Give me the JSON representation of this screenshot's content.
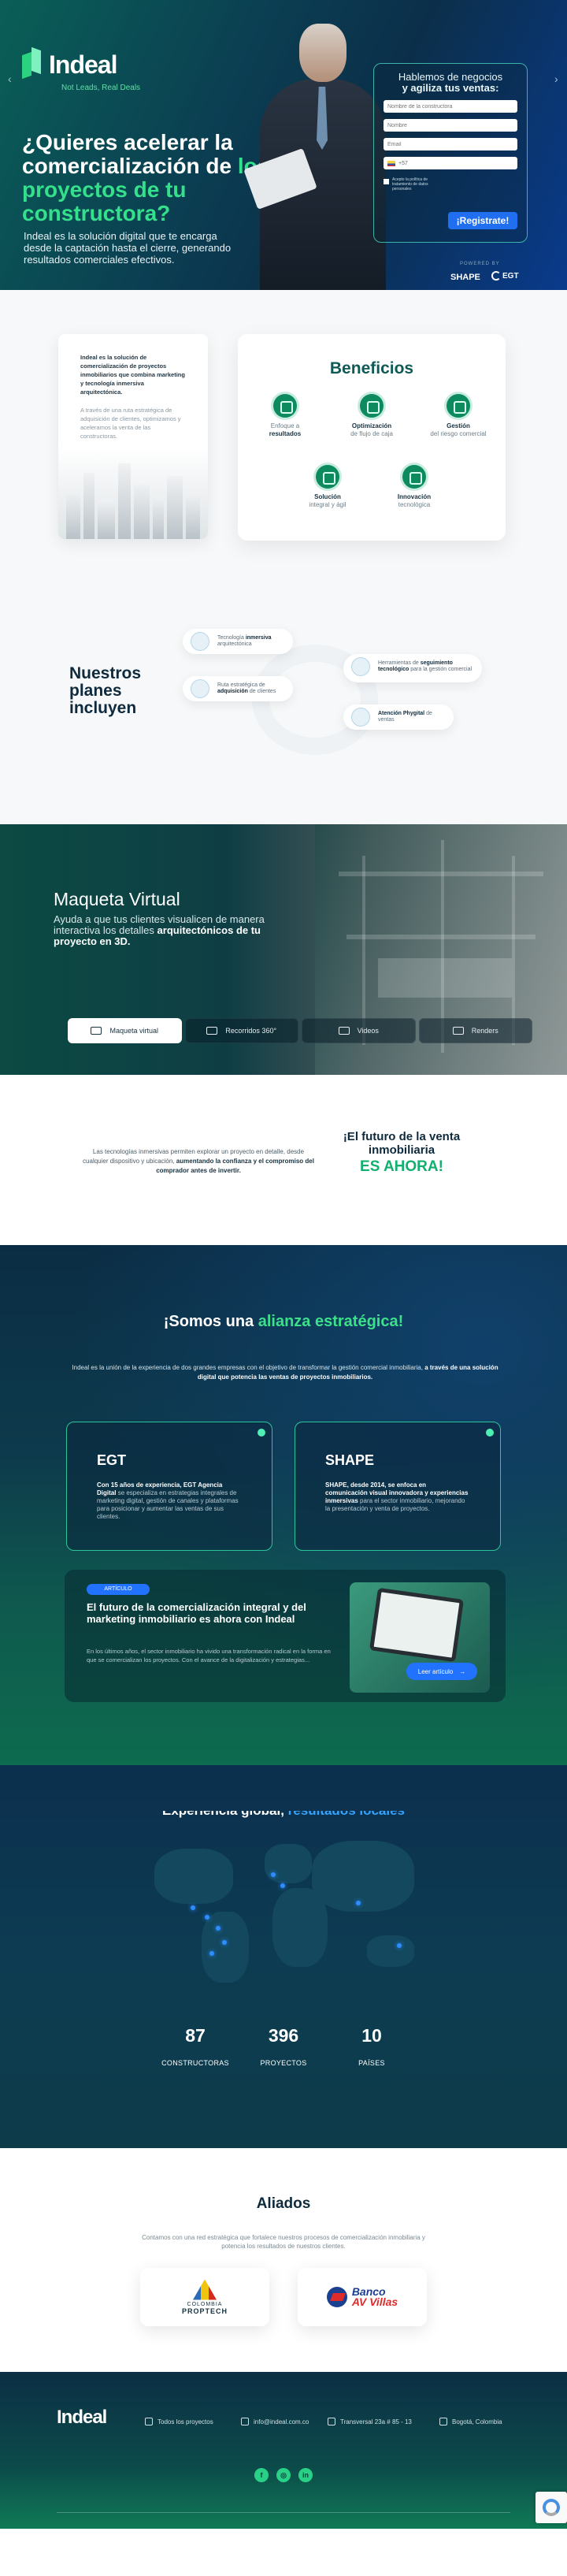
{
  "brand": {
    "name": "Indeal",
    "tagline": "Not Leads, Real Deals"
  },
  "hero": {
    "title_1": "¿Quieres acelerar la comercialización de",
    "title_2": "los proyectos de tu constructora?",
    "lead": "Indeal es la solución digital que te encarga desde la captación hasta el cierre, generando resultados comerciales efectivos.",
    "prev": "‹",
    "next": "›",
    "powered": "POWERED BY",
    "shape": "SHAPE",
    "egt": "EGT"
  },
  "form": {
    "title_1": "Hablemos de negocios",
    "title_2": "y agiliza tus ventas:",
    "company_placeholder": "Nombre de la constructora",
    "name_placeholder": "Nombre",
    "email_placeholder": "Email",
    "phone_prefix": "+57",
    "consent": "Acepto la política de tratamiento de datos personales",
    "submit": "¡Registrate!"
  },
  "intro": {
    "p1": "Indeal es la solución de comercialización de proyectos inmobiliarios que combina marketing y tecnología inmersiva arquitectónica.",
    "p2": "A través de una ruta estratégica de adquisición de clientes, optimizamos y aceleramos la venta de las constructoras."
  },
  "benefits": {
    "title": "Beneficios",
    "items": [
      {
        "pre": "Enfoque a",
        "b": "resultados"
      },
      {
        "pre": "",
        "b": "Optimización",
        "post": "de flujo de caja"
      },
      {
        "pre": "",
        "b": "Gestión",
        "post": "del riesgo comercial"
      },
      {
        "pre": "",
        "b": "Solución",
        "post": "integral y ágil"
      },
      {
        "pre": "",
        "b": "Innovación",
        "post": "tecnológica"
      }
    ]
  },
  "plans": {
    "title": "Nuestros planes incluyen",
    "items": [
      {
        "pre": "Tecnología",
        "b": "inmersiva",
        "post": "arquitectónica"
      },
      {
        "pre": "Ruta estratégica de",
        "b": "adquisición",
        "post": "de clientes"
      },
      {
        "pre": "Herramientas de",
        "b": "seguimiento tecnológico",
        "post": "para la gestión comercial"
      },
      {
        "pre": "",
        "b": "Atención Phygital",
        "post": "de ventas"
      }
    ]
  },
  "maqueta": {
    "title": "Maqueta Virtual",
    "text": "Ayuda a que tus clientes visualicen de manera interactiva los detalles",
    "text_b": "arquitectónicos de tu proyecto en 3D.",
    "tabs": [
      "Maqueta virtual",
      "Recorridos 360°",
      "Videos",
      "Renders"
    ]
  },
  "future": {
    "text_1": "Las tecnologías inmersivas permiten explorar un proyecto en detalle, desde cualquier dispositivo y ubicación,",
    "text_b": "aumentando la confianza y el compromiso del comprador antes de invertir.",
    "title_a": "¡El futuro de la venta inmobiliaria",
    "title_b": "ES AHORA!"
  },
  "alianza": {
    "title_1": "¡Somos una",
    "title_2": "alianza estratégica!",
    "desc": "Indeal es la unión de la experiencia de dos grandes empresas con el objetivo de transformar la gestión comercial inmobiliaria,",
    "desc_b": "a través de una solución digital que potencia las ventas de proyectos inmobiliarios.",
    "cards": [
      {
        "logo": "EGT",
        "b": "Con 15 años de experiencia, EGT Agencia Digital",
        "text": "se especializa en estrategias integrales de marketing digital, gestión de canales y plataformas para posicionar y aumentar las ventas de sus clientes."
      },
      {
        "logo": "SHAPE",
        "b": "SHAPE, desde 2014, se enfoca en comunicación visual innovadora y experiencias inmersivas",
        "text": "para el sector inmobiliario, mejorando la presentación y venta de proyectos."
      }
    ],
    "article": {
      "badge": "ARTÍCULO",
      "title": "El futuro de la comercialización integral y del marketing inmobiliario es ahora con Indeal",
      "text": "En los últimos años, el sector inmobiliario ha vivido una transformación radical en la forma en que se comercializan los proyectos. Con el avance de la digitalización y estrategias...",
      "button": "Leer artículo"
    }
  },
  "experience": {
    "title_1": "Experiencia global,",
    "title_2": "resultados locales",
    "stats": [
      {
        "n": "87",
        "l": "CONSTRUCTORAS"
      },
      {
        "n": "396",
        "l": "PROYECTOS"
      },
      {
        "n": "10",
        "l": "PAÍSES"
      }
    ]
  },
  "aliados": {
    "title": "Aliados",
    "desc": "Contamos con una red estratégica que fortalece nuestros procesos de comercialización inmobiliaria y potencia los resultados de nuestros clientes.",
    "colombia_1": "COLOMBIA",
    "colombia_2": "PROPTECH",
    "av_1": "Banco",
    "av_2": "AV Villas"
  },
  "footer": {
    "logo": "Indeal",
    "items": [
      "Todos los proyectos",
      "info@indeal.com.co",
      "Transversal 23a # 85 - 13",
      "Bogotá, Colombia"
    ],
    "social": [
      "f",
      "◎",
      "in"
    ]
  }
}
